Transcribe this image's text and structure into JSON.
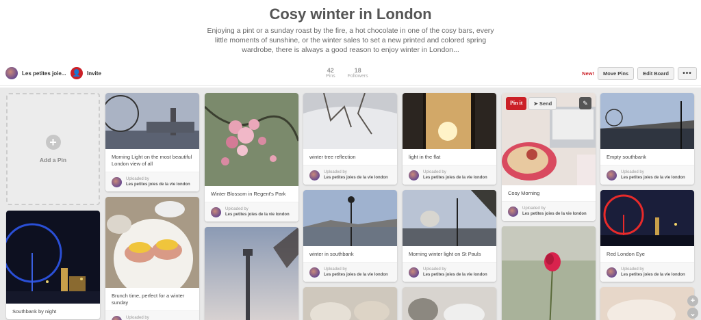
{
  "board": {
    "title": "Cosy winter in London",
    "description": "Enjoying a pint or a sunday roast by the fire, a hot chocolate in one of the cosy bars, every little moments of sunshine, or the winter sales to set a new printed and colored spring wardrobe, there is always a good reason to enjoy winter in London..."
  },
  "owner": {
    "name": "Les petites joie...",
    "invite_label": "Invite"
  },
  "stats": {
    "pins": "42",
    "pins_label": "Pins",
    "followers": "18",
    "followers_label": "Followers"
  },
  "actions": {
    "new_badge": "New!",
    "move_pins": "Move Pins",
    "edit_board": "Edit Board",
    "more": "•••"
  },
  "add_pin": {
    "icon": "+",
    "label": "Add a Pin"
  },
  "credit": {
    "uploaded_by": "Uploaded by",
    "name": "Les petites joies de la vie london"
  },
  "hover": {
    "pinit": "Pin it",
    "send": "Send",
    "edit_icon": "✎"
  },
  "pins": {
    "c1p1": "Southbank by night",
    "c2p1": "Morning Light on the most beautiful London view of all",
    "c2p2": "Brunch time, perfect for a winter sunday",
    "c3p1": "Winter Blossom in Regent's Park",
    "c4p1": "winter tree reflection",
    "c4p2": "winter in southbank",
    "c5p1": "light in the flat",
    "c5p2": "Morning winter light on St Pauls",
    "c6p1": "Cosy Morning",
    "c7p1": "Empty southbank",
    "c7p2": "Red London Eye"
  },
  "colors": {
    "accent": "#cb2027",
    "background": "#e9e9e9"
  }
}
